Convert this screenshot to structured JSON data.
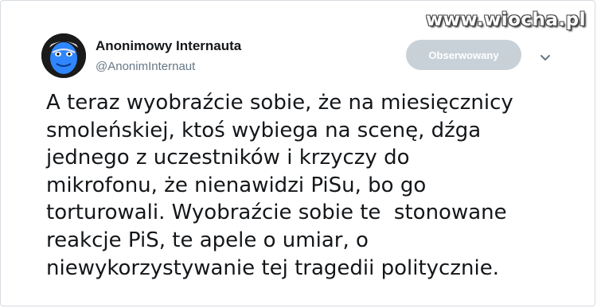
{
  "author": {
    "display_name": "Anonimowy Internauta",
    "handle": "@AnonimInternaut"
  },
  "follow_button_label": "Obserwowany",
  "watermark": "www.wiocha.pl",
  "icons": {
    "avatar": "avatar-face-icon",
    "more": "chevron-down-icon"
  },
  "colors": {
    "follow_button": "#c9d1d8",
    "name": "#14171a",
    "handle": "#657786"
  },
  "tweet_lines": [
    "A teraz wyobraźcie sobie, że na miesięcznicy",
    "smoleńskiej, ktoś wybiega na scenę, dźga",
    "jednego z uczestników i krzyczy do",
    "mikrofonu, że nienawidzi PiSu, bo go",
    "torturowali. Wyobraźcie sobie te  stonowane",
    "reakcje PiS, te apele o umiar, o",
    "niewykorzystywanie tej tragedii politycznie."
  ]
}
